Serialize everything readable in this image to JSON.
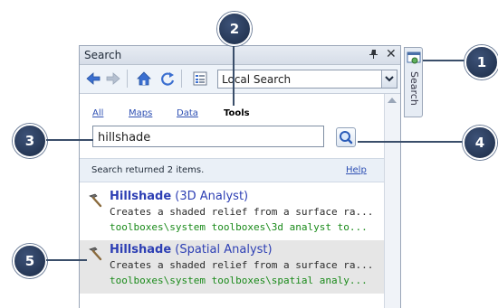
{
  "window": {
    "title": "Search"
  },
  "toolbar": {
    "dropdown_value": "Local Search"
  },
  "tabs": [
    {
      "label": "All"
    },
    {
      "label": "Maps"
    },
    {
      "label": "Data"
    },
    {
      "label": "Tools"
    }
  ],
  "search": {
    "value": "hillshade"
  },
  "results_bar": {
    "text": "Search returned 2 items.",
    "help_label": "Help"
  },
  "results": [
    {
      "name": "Hillshade",
      "toolbox": "(3D Analyst)",
      "description": "Creates a shaded relief from a surface ra...",
      "path": "toolboxes\\system toolboxes\\3d analyst to..."
    },
    {
      "name": "Hillshade",
      "toolbox": "(Spatial Analyst)",
      "description": "Creates a shaded relief from a surface ra...",
      "path": "toolboxes\\system toolboxes\\spatial analy..."
    }
  ],
  "side_tab": {
    "label": "Search"
  },
  "callouts": [
    "1",
    "2",
    "3",
    "4",
    "5"
  ],
  "colors": {
    "callout": "#1c2c46",
    "link": "#2d4fb3",
    "path_green": "#1a8a1a",
    "title_blue": "#2d3fb4"
  }
}
